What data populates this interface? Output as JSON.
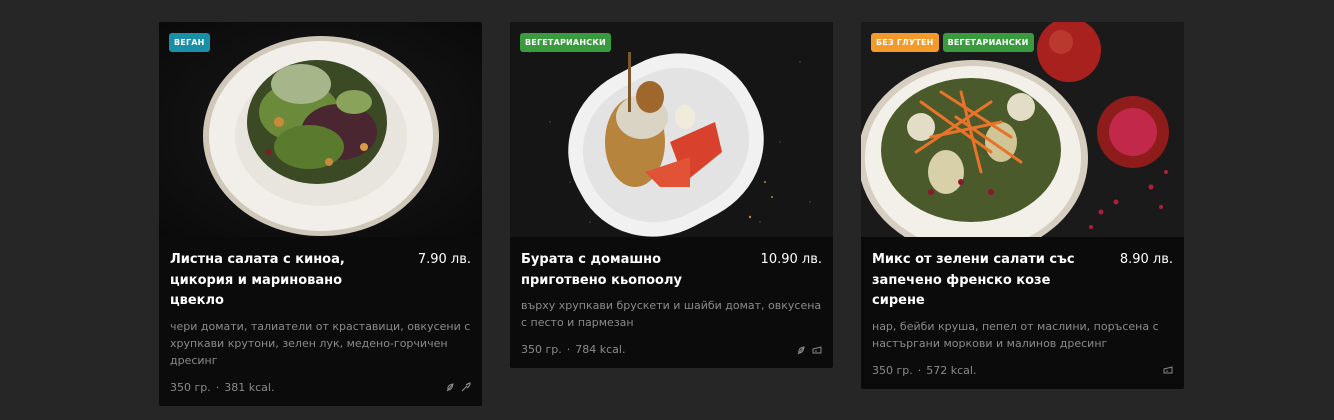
{
  "colors": {
    "vegan": "#1a8fa8",
    "vegetarian": "#3a9a3e",
    "gluten_free": "#f39a2b"
  },
  "cards": [
    {
      "badges": [
        {
          "label": "ВЕГАН",
          "color": "#1a8fa8"
        }
      ],
      "title": "Листна салата с киноа, цикория и мариновано цвекло",
      "price": "7.90 лв.",
      "description": "чери домати, талиатели от краставици, овкусени с хрупкави крутони, зелен лук, медено-горчичен дресинг",
      "weight": "350 гр.",
      "sep": "·",
      "kcal": "381 kcal.",
      "icons": [
        "leaf-icon",
        "vegan-icon"
      ]
    },
    {
      "badges": [
        {
          "label": "ВЕГЕТАРИАНСКИ",
          "color": "#3a9a3e"
        }
      ],
      "title": "Бурата с домашно приготвено кьопоолу",
      "price": "10.90 лв.",
      "description": "върху хрупкави брускети и шайби домат, овкусена с песто и пармезан",
      "weight": "350 гр.",
      "sep": "·",
      "kcal": "784 kcal.",
      "icons": [
        "leaf-icon",
        "cheese-icon"
      ]
    },
    {
      "badges": [
        {
          "label": "БЕЗ ГЛУТЕН",
          "color": "#f39a2b"
        },
        {
          "label": "ВЕГЕТАРИАНСКИ",
          "color": "#3a9a3e"
        }
      ],
      "title": "Микс от зелени салати със запечено френско козе сирене",
      "price": "8.90 лв.",
      "description": "нар, бейби круша, пепел от маслини, поръсена с настъргани моркови и малинов дресинг",
      "weight": "350 гр.",
      "sep": "·",
      "kcal": "572 kcal.",
      "icons": [
        "cheese-icon"
      ]
    }
  ]
}
